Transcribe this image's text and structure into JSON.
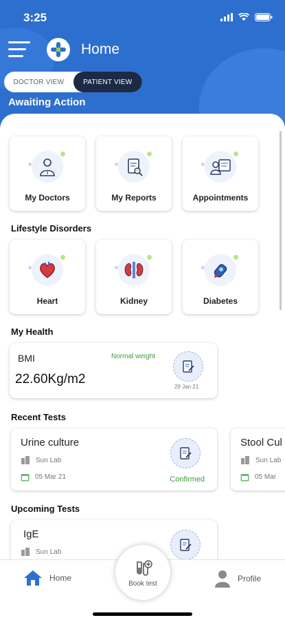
{
  "status_bar": {
    "time": "3:25"
  },
  "header": {
    "title": "Home"
  },
  "view_toggle": {
    "doctor": "DOCTOR VIEW",
    "patient": "PATIENT VIEW",
    "selected": "patient"
  },
  "awaiting_action": "Awaiting Action",
  "quick_tiles": [
    {
      "label": "My Doctors",
      "icon": "doctor-icon"
    },
    {
      "label": "My Reports",
      "icon": "report-icon"
    },
    {
      "label": "Appointments",
      "icon": "appointment-icon"
    }
  ],
  "lifestyle": {
    "title": "Lifestyle Disorders",
    "items": [
      {
        "label": "Heart",
        "icon": "heart-icon"
      },
      {
        "label": "Kidney",
        "icon": "kidney-icon"
      },
      {
        "label": "Diabetes",
        "icon": "glucometer-icon"
      }
    ]
  },
  "my_health": {
    "title": "My Health",
    "bmi": {
      "label": "BMI",
      "status": "Normal weight",
      "value": "22.60Kg/m2",
      "date": "29 Jan 21"
    }
  },
  "recent_tests": {
    "title": "Recent Tests",
    "items": [
      {
        "name": "Urine culture",
        "lab": "Sun Lab",
        "date": "05 Mar 21",
        "status": "Confirmed"
      },
      {
        "name": "Stool Cul",
        "lab": "Sun Lab",
        "date": "05 Mar"
      }
    ]
  },
  "upcoming_tests": {
    "title": "Upcoming Tests",
    "items": [
      {
        "name": "IgE",
        "lab": "Sun Lab"
      }
    ]
  },
  "bottom_nav": {
    "home": "Home",
    "book_test": "Book test",
    "profile": "Profile"
  },
  "colors": {
    "primary": "#2c6fcf",
    "toggle_active": "#1c2a45",
    "success": "#3e9b3e"
  }
}
